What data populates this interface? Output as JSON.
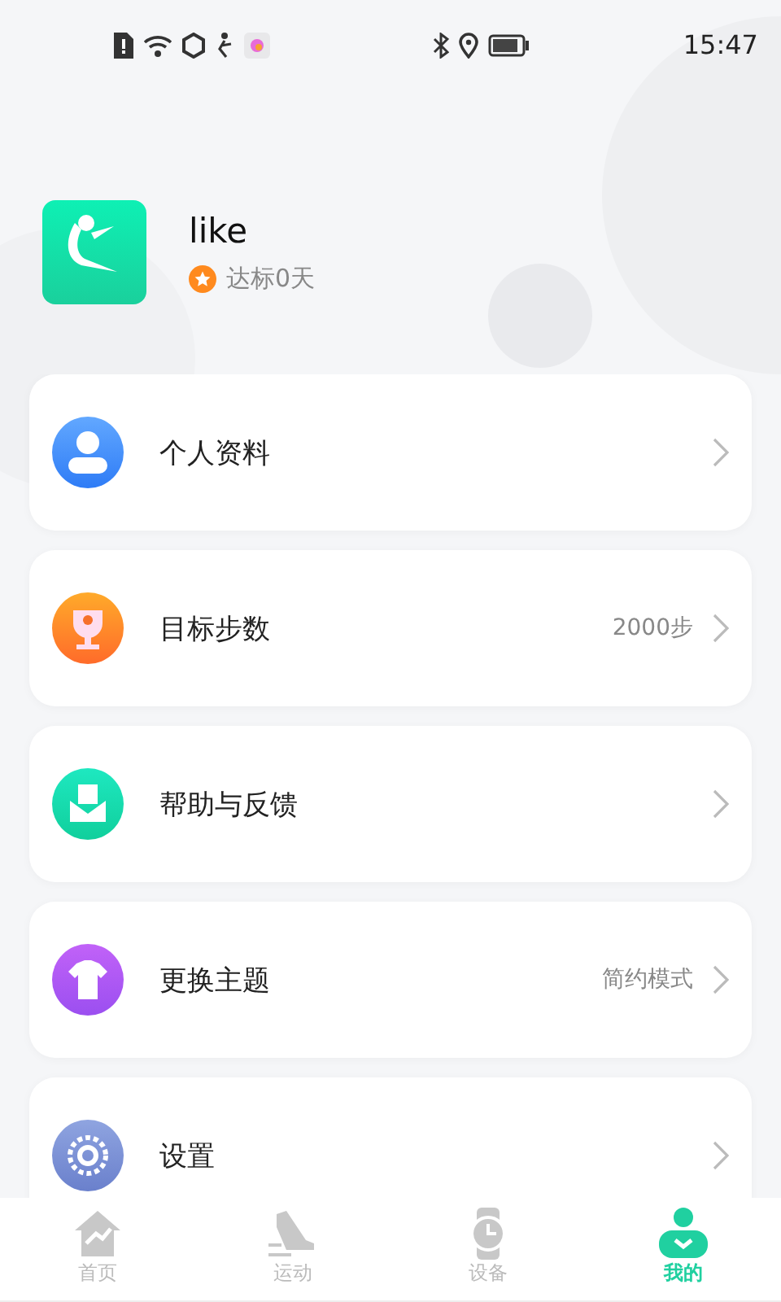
{
  "status_bar": {
    "time": "15:47"
  },
  "profile": {
    "name": "like",
    "badge": "达标0天"
  },
  "menu": [
    {
      "kind": "profile",
      "label": "个人资料"
    },
    {
      "kind": "trophy",
      "label": "目标步数",
      "value": "2000步"
    },
    {
      "kind": "help",
      "label": "帮助与反馈"
    },
    {
      "kind": "theme",
      "label": "更换主题",
      "value": "简约模式"
    },
    {
      "kind": "settings",
      "label": "设置"
    }
  ],
  "tabs": [
    {
      "kind": "home",
      "label": "首页",
      "selected": false
    },
    {
      "kind": "sport",
      "label": "运动",
      "selected": false
    },
    {
      "kind": "device",
      "label": "设备",
      "selected": false
    },
    {
      "kind": "mine",
      "label": "我的",
      "selected": true
    }
  ]
}
